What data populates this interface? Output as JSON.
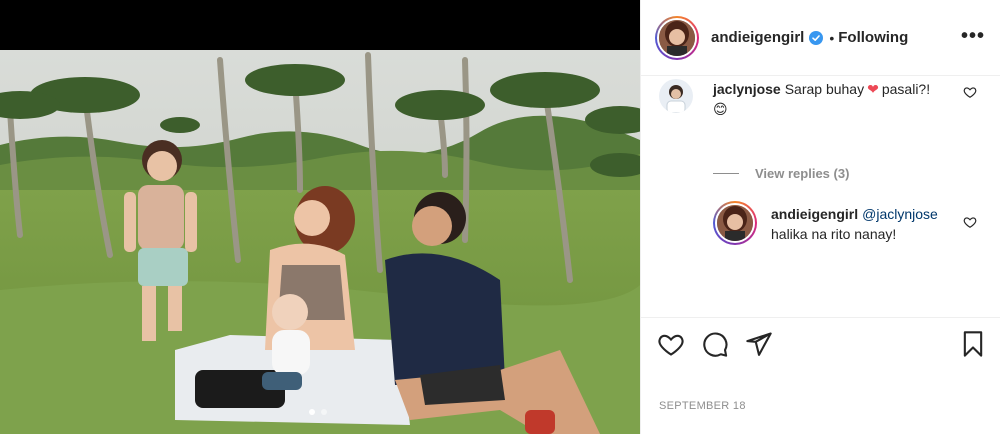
{
  "post": {
    "author": "andieigengirl",
    "separator": "•",
    "follow_label": "Following",
    "more_label": "•••",
    "date": "SEPTEMBER 18",
    "verified": true
  },
  "comments": [
    {
      "user": "jaclynjose",
      "text": "Sarap buhay",
      "text_after": "pasali?!",
      "emoji_heart": "❤",
      "emoji_smile": "😊"
    },
    {
      "view_replies": "View replies (3)"
    },
    {
      "user": "andieigengirl",
      "mention": "@jaclynjose",
      "text": "halika na rito nanay!"
    }
  ],
  "icons": {
    "like": "heart-icon",
    "comment": "comment-icon",
    "share": "share-icon",
    "save": "bookmark-icon",
    "verified": "verified-badge-icon",
    "more": "more-options-icon"
  },
  "colors": {
    "text": "#262626",
    "muted": "#8e8e8e",
    "mention": "#00376b",
    "verified": "#3897f0",
    "heart_emoji": "#ed4956"
  }
}
